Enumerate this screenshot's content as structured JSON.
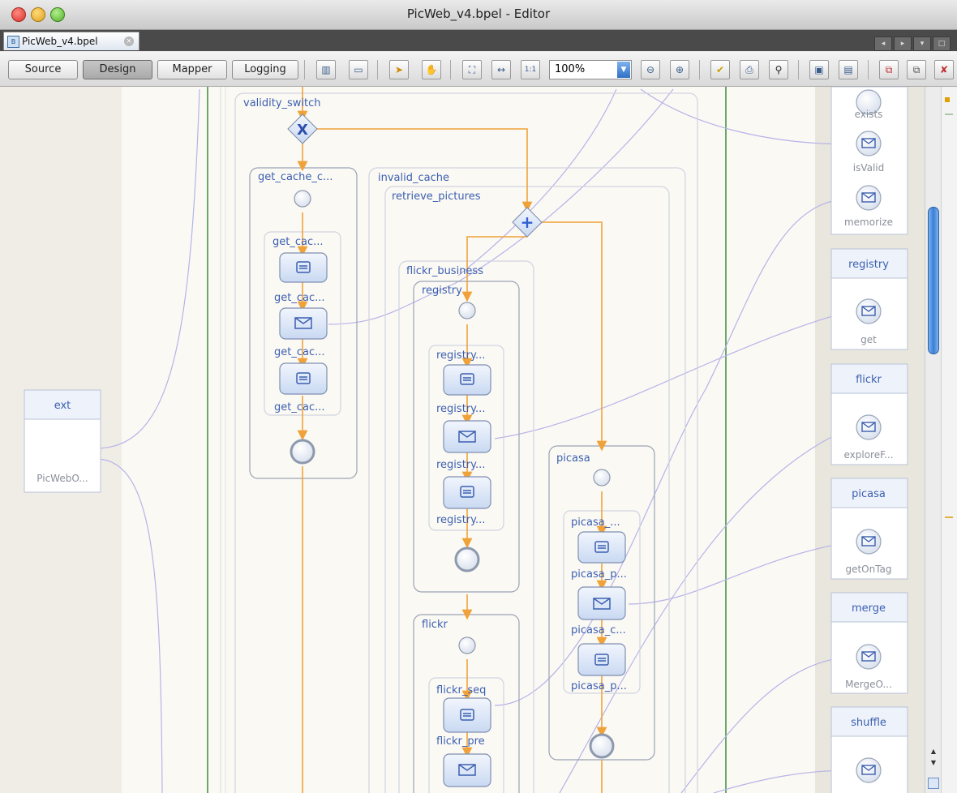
{
  "window": {
    "title": "PicWeb_v4.bpel - Editor",
    "doc_tab": "PicWeb_v4.bpel"
  },
  "toolbar": {
    "view_buttons": [
      "Source",
      "Design",
      "Mapper",
      "Logging"
    ],
    "active_view": "Design",
    "zoom": "100%"
  },
  "partners_left": {
    "header": "ext",
    "op": "PicWebO..."
  },
  "partners_right": [
    {
      "header": "",
      "ops": [
        "exists",
        "isValid",
        "memorize"
      ]
    },
    {
      "header": "registry",
      "ops": [
        "get"
      ]
    },
    {
      "header": "flickr",
      "ops": [
        "exploreF..."
      ]
    },
    {
      "header": "picasa",
      "ops": [
        "getOnTag"
      ]
    },
    {
      "header": "merge",
      "ops": [
        "MergeO..."
      ]
    },
    {
      "header": "shuffle",
      "ops": []
    }
  ],
  "process": {
    "validity_switch": "validity_switch",
    "get_cache": "get_cache_c...",
    "get_cache_seq": "get_cac...",
    "get_cache_act1": "get_cac...",
    "get_cache_act2": "get_cac...",
    "get_cache_act3": "get_cac...",
    "invalid_cache": "invalid_cache",
    "retrieve_pictures": "retrieve_pictures",
    "flickr_business": "flickr_business",
    "registry": "registry",
    "registry_seq": "registry...",
    "registry_act1": "registry...",
    "registry_act2": "registry...",
    "registry_act3": "registry...",
    "flickr": "flickr",
    "flickr_seq": "flickr_seq",
    "flickr_pre": "flickr_pre",
    "picasa": "picasa",
    "picasa_seq": "picasa_...",
    "picasa_act1": "picasa_p...",
    "picasa_act2": "picasa_c...",
    "picasa_act3": "picasa_p..."
  },
  "colors": {
    "label_blue": "#3b5fb0",
    "flow_orange": "#f0a23a",
    "link_lavender": "#b7b3e8",
    "lane_green": "#6aa86a"
  }
}
